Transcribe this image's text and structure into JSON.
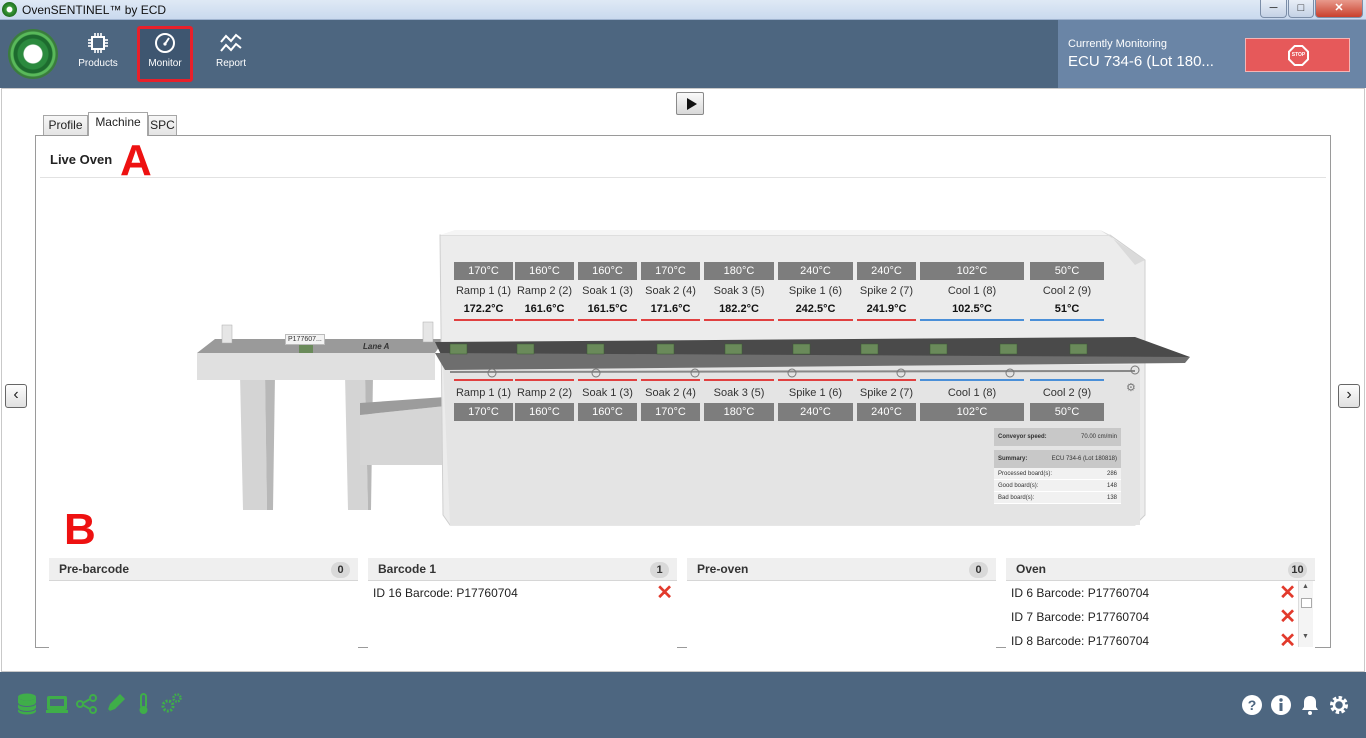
{
  "window": {
    "title": "OvenSENTINEL™ by ECD",
    "min_label": "─",
    "max_label": "□",
    "close_label": "✕"
  },
  "nav": {
    "items": [
      {
        "label": "Products",
        "icon": "chip-icon"
      },
      {
        "label": "Monitor",
        "icon": "gauge-icon"
      },
      {
        "label": "Report",
        "icon": "trend-icon"
      }
    ]
  },
  "monitoring": {
    "label": "Currently Monitoring",
    "value": "ECU 734-6 (Lot 180...",
    "stop_label": "STOP"
  },
  "tabs": [
    {
      "label": "Profile"
    },
    {
      "label": "Machine"
    },
    {
      "label": "SPC"
    }
  ],
  "panel": {
    "title": "Live Oven"
  },
  "annotations": {
    "a": "A",
    "b": "B"
  },
  "oven": {
    "lane_label": "Lane A",
    "board_tag": "P177607...",
    "top_zones": [
      {
        "set": "170°C",
        "name": "Ramp 1 (1)",
        "actual": "172.2°C",
        "color": "#e04040"
      },
      {
        "set": "160°C",
        "name": "Ramp 2 (2)",
        "actual": "161.6°C",
        "color": "#e04040"
      },
      {
        "set": "160°C",
        "name": "Soak 1 (3)",
        "actual": "161.5°C",
        "color": "#e04040"
      },
      {
        "set": "170°C",
        "name": "Soak 2 (4)",
        "actual": "171.6°C",
        "color": "#e04040"
      },
      {
        "set": "180°C",
        "name": "Soak 3 (5)",
        "actual": "182.2°C",
        "color": "#e04040"
      },
      {
        "set": "240°C",
        "name": "Spike 1 (6)",
        "actual": "242.5°C",
        "color": "#e04040"
      },
      {
        "set": "240°C",
        "name": "Spike 2 (7)",
        "actual": "241.9°C",
        "color": "#e04040"
      },
      {
        "set": "102°C",
        "name": "Cool 1 (8)",
        "actual": "102.5°C",
        "color": "#4a8fd8"
      },
      {
        "set": "50°C",
        "name": "Cool 2 (9)",
        "actual": "51°C",
        "color": "#4a8fd8"
      }
    ],
    "bottom_zones": [
      {
        "name": "Ramp 1 (1)",
        "set": "170°C",
        "color": "#e04040"
      },
      {
        "name": "Ramp 2 (2)",
        "set": "160°C",
        "color": "#e04040"
      },
      {
        "name": "Soak 1 (3)",
        "set": "160°C",
        "color": "#e04040"
      },
      {
        "name": "Soak 2 (4)",
        "set": "170°C",
        "color": "#e04040"
      },
      {
        "name": "Soak 3 (5)",
        "set": "180°C",
        "color": "#e04040"
      },
      {
        "name": "Spike 1 (6)",
        "set": "240°C",
        "color": "#e04040"
      },
      {
        "name": "Spike 2 (7)",
        "set": "240°C",
        "color": "#e04040"
      },
      {
        "name": "Cool 1 (8)",
        "set": "102°C",
        "color": "#4a8fd8"
      },
      {
        "name": "Cool 2 (9)",
        "set": "50°C",
        "color": "#4a8fd8"
      }
    ],
    "summary": {
      "speed_label": "Conveyor speed:",
      "speed_value": "70.00 cm/min",
      "summary_label": "Summary:",
      "summary_value": "ECU 734-6 (Lot 180818)",
      "processed_label": "Processed board(s):",
      "processed_value": "286",
      "good_label": "Good board(s):",
      "good_value": "148",
      "bad_label": "Bad board(s):",
      "bad_value": "138"
    }
  },
  "queues": [
    {
      "title": "Pre-barcode",
      "count": "0",
      "items": []
    },
    {
      "title": "Barcode 1",
      "count": "1",
      "items": [
        "ID 16 Barcode: P17760704"
      ]
    },
    {
      "title": "Pre-oven",
      "count": "0",
      "items": []
    },
    {
      "title": "Oven",
      "count": "10",
      "items": [
        "ID 6 Barcode: P17760704",
        "ID 7 Barcode: P17760704",
        "ID 8 Barcode: P17760704"
      ]
    }
  ],
  "footer": {
    "left_icons": [
      "database-icon",
      "oven-icon",
      "share-icon",
      "pen-icon",
      "thermometer-icon",
      "gears-icon"
    ],
    "right_icons": [
      "help-icon",
      "info-icon",
      "bell-icon",
      "settings-icon"
    ],
    "accent": "#3fae49"
  }
}
